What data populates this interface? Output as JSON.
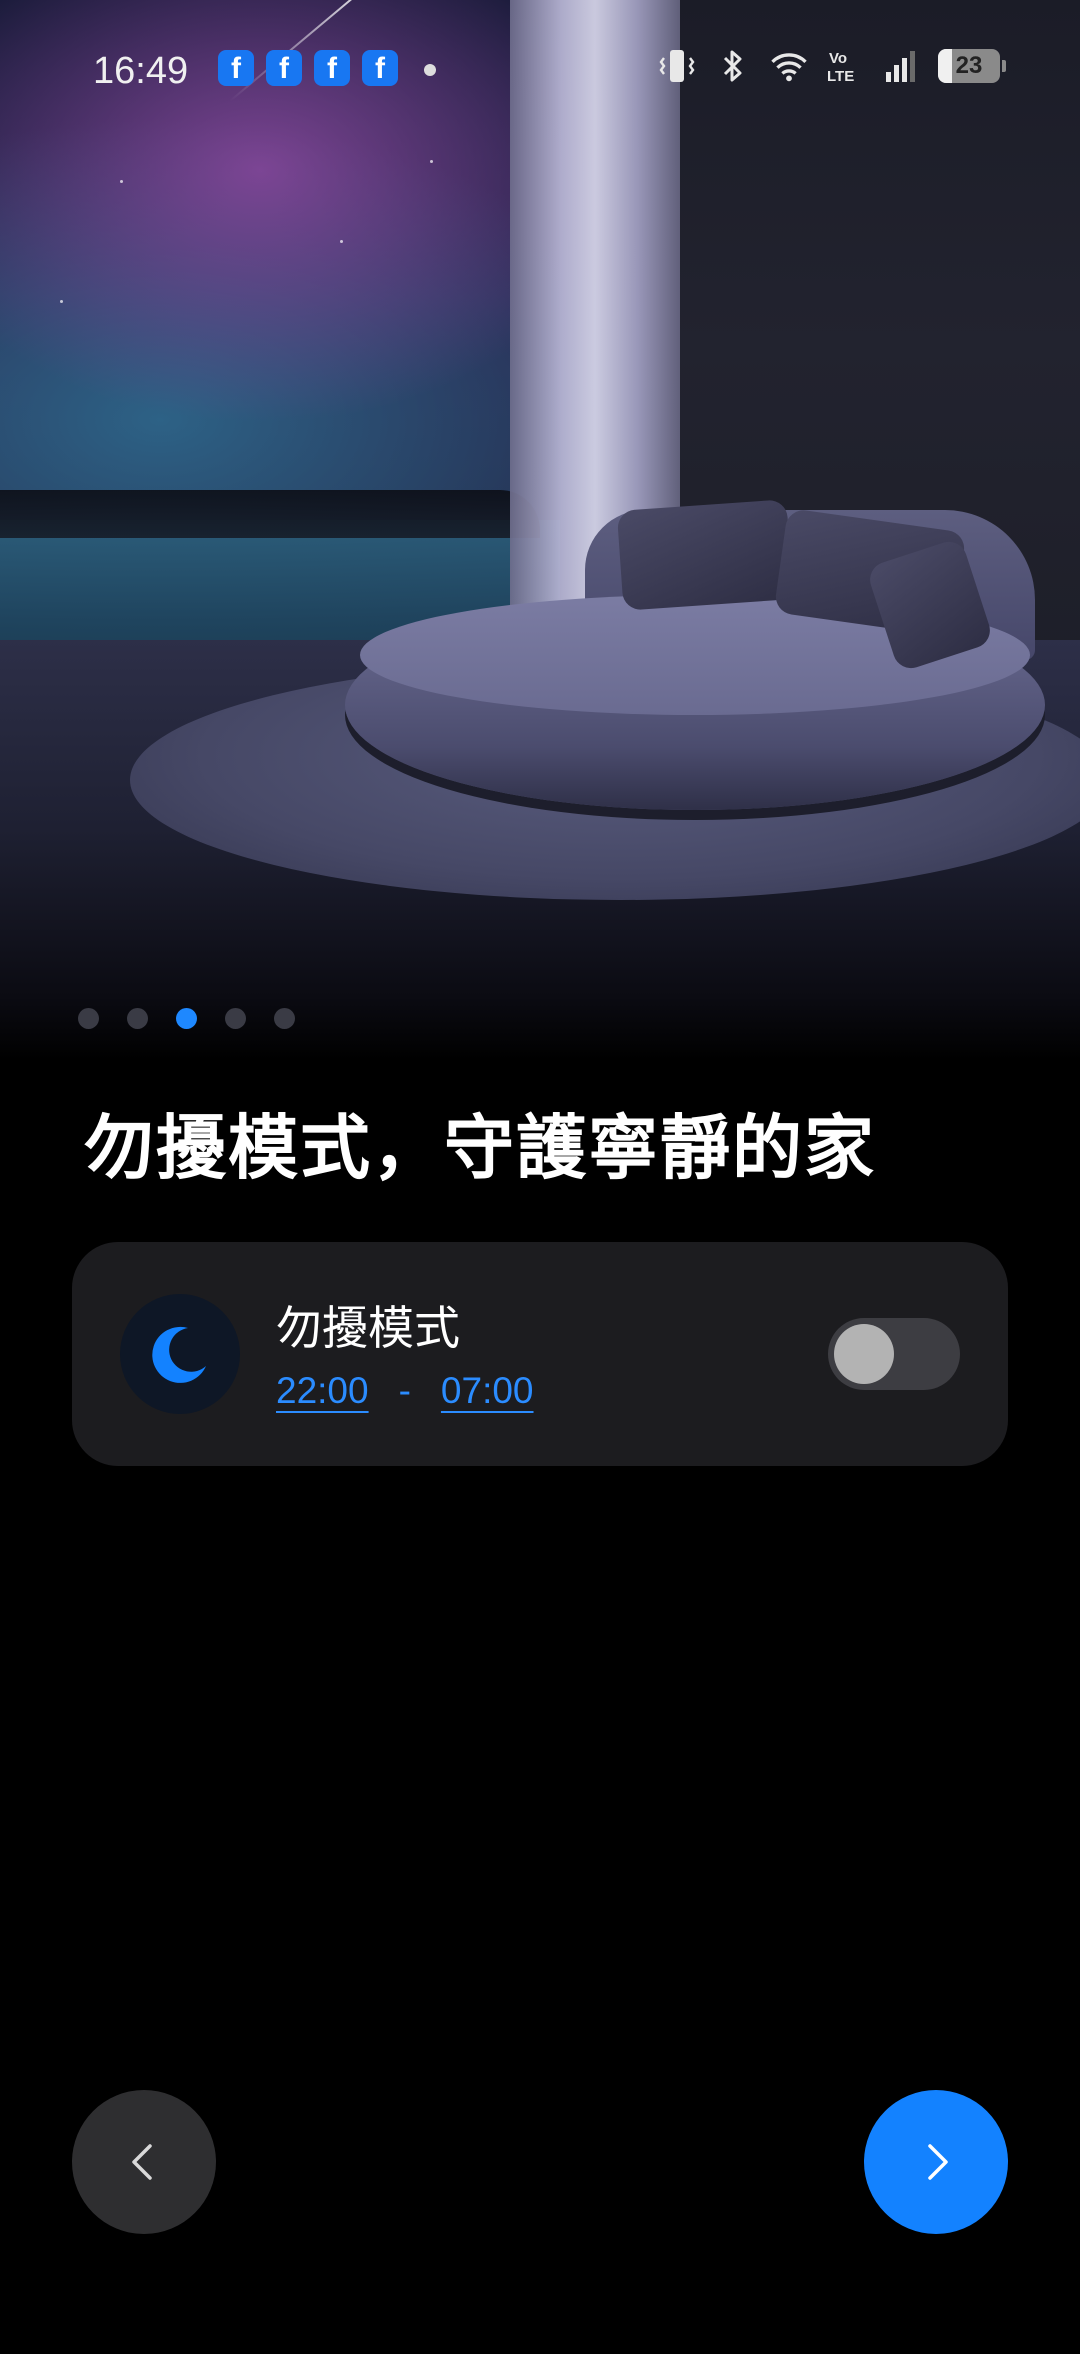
{
  "status_bar": {
    "time": "16:49",
    "notification_icons": [
      "facebook-icon",
      "facebook-icon",
      "facebook-icon",
      "facebook-icon"
    ],
    "fb_letter": "f",
    "battery_level": "23",
    "icons": [
      "vibrate-icon",
      "bluetooth-icon",
      "wifi-icon",
      "volte-icon",
      "signal-icon",
      "battery-icon"
    ]
  },
  "pager": {
    "total": 5,
    "active_index": 2
  },
  "page_title": "勿擾模式，守護寧靜的家",
  "dnd_card": {
    "label": "勿擾模式",
    "start_time": "22:00",
    "separator": "-",
    "end_time": "07:00",
    "toggle_on": false
  },
  "colors": {
    "accent": "#1382ff",
    "card_bg": "#1c1c1f",
    "link": "#2b8cff"
  }
}
